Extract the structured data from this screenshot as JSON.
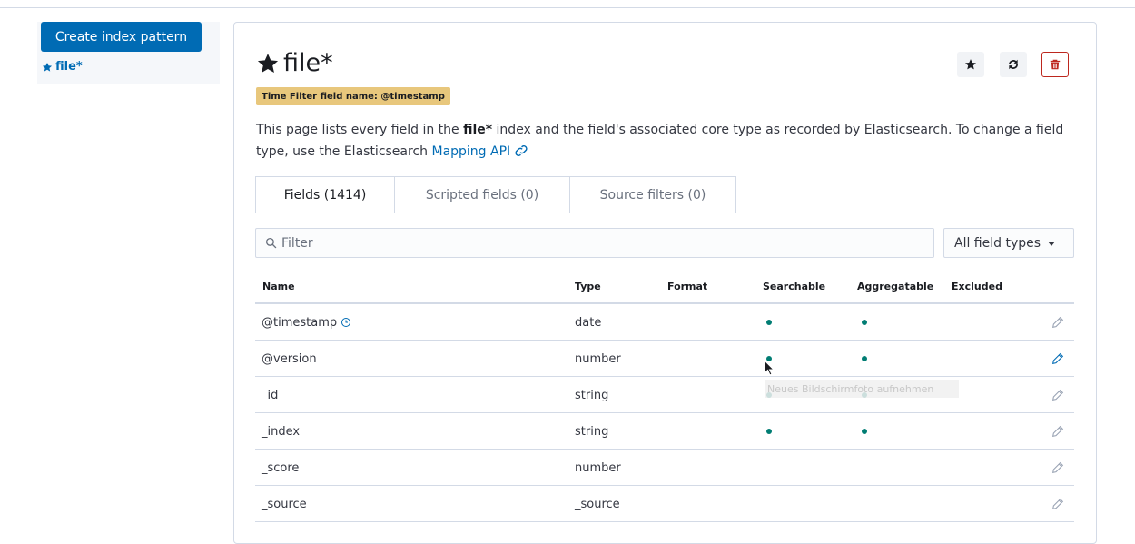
{
  "sidebar": {
    "create_button": "Create index pattern",
    "pattern_link": "file*"
  },
  "header": {
    "title": "file*",
    "time_badge": "Time Filter field name: @timestamp",
    "actions": [
      "star-icon",
      "refresh-icon",
      "delete-icon"
    ]
  },
  "description": {
    "part1": "This page lists every field in the ",
    "bold": "file*",
    "part2": " index and the field's associated core type as recorded by Elasticsearch. To change a field type, use the Elasticsearch ",
    "link": "Mapping API"
  },
  "tabs": [
    {
      "label": "Fields (1414)"
    },
    {
      "label": "Scripted fields (0)"
    },
    {
      "label": "Source filters (0)"
    }
  ],
  "filter": {
    "placeholder": "Filter"
  },
  "type_select": {
    "value": "All field types"
  },
  "table": {
    "headers": [
      "Name",
      "Type",
      "Format",
      "Searchable",
      "Aggregatable",
      "Excluded"
    ],
    "rows": [
      {
        "name": "@timestamp",
        "type": "date",
        "format": "",
        "searchable": true,
        "aggregatable": true,
        "excluded": false,
        "time_field": true
      },
      {
        "name": "@version",
        "type": "number",
        "format": "",
        "searchable": true,
        "aggregatable": true,
        "excluded": false,
        "time_field": false
      },
      {
        "name": "_id",
        "type": "string",
        "format": "",
        "searchable": true,
        "aggregatable": true,
        "excluded": false,
        "time_field": false
      },
      {
        "name": "_index",
        "type": "string",
        "format": "",
        "searchable": true,
        "aggregatable": true,
        "excluded": false,
        "time_field": false
      },
      {
        "name": "_score",
        "type": "number",
        "format": "",
        "searchable": false,
        "aggregatable": false,
        "excluded": false,
        "time_field": false
      },
      {
        "name": "_source",
        "type": "_source",
        "format": "",
        "searchable": false,
        "aggregatable": false,
        "excluded": false,
        "time_field": false
      }
    ]
  },
  "tooltip": {
    "text": "Neues Bildschirmfoto aufnehmen"
  },
  "colors": {
    "primary": "#006bb4",
    "dot": "#017d73",
    "badge": "#e8c77c",
    "danger": "#bd271e"
  }
}
